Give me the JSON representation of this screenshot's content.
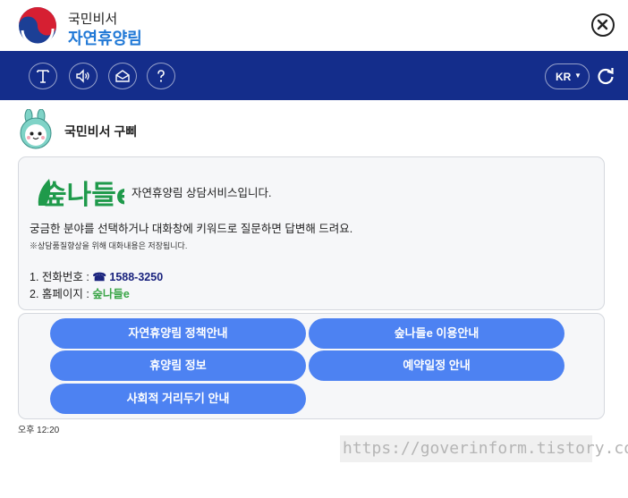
{
  "header": {
    "brand_top": "국민비서",
    "brand_main": "자연휴양림"
  },
  "toolbar": {
    "lang": "KR",
    "tools": [
      "text-size-icon",
      "speaker-icon",
      "mail-icon",
      "help-icon"
    ]
  },
  "bot": {
    "name": "국민비서 구삐"
  },
  "message": {
    "logo_text": "숲나들e",
    "intro": "자연휴양림 상담서비스입니다.",
    "guide": "궁금한 분야를 선택하거나 대화창에 키워드로 질문하면 답변해 드려요.",
    "note": "※상담품질향상을 위해 대화내용은 저장됩니다.",
    "phone_label": "1. 전화번호 : ",
    "phone_value": "☎ 1588-3250",
    "home_label": "2. 홈페이지 : ",
    "home_value": "숲나들e"
  },
  "menu": {
    "buttons": [
      "자연휴양림 정책안내",
      "숲나들e 이용안내",
      "휴양림 정보",
      "예약일정 안내",
      "사회적 거리두기 안내"
    ]
  },
  "time": "오후 12:20",
  "watermark": "https://goverinform.tistory.com",
  "colors": {
    "toolbar": "#142d8b",
    "button": "#4d82f2",
    "brand": "#1f78d6",
    "green": "#3aa547"
  }
}
